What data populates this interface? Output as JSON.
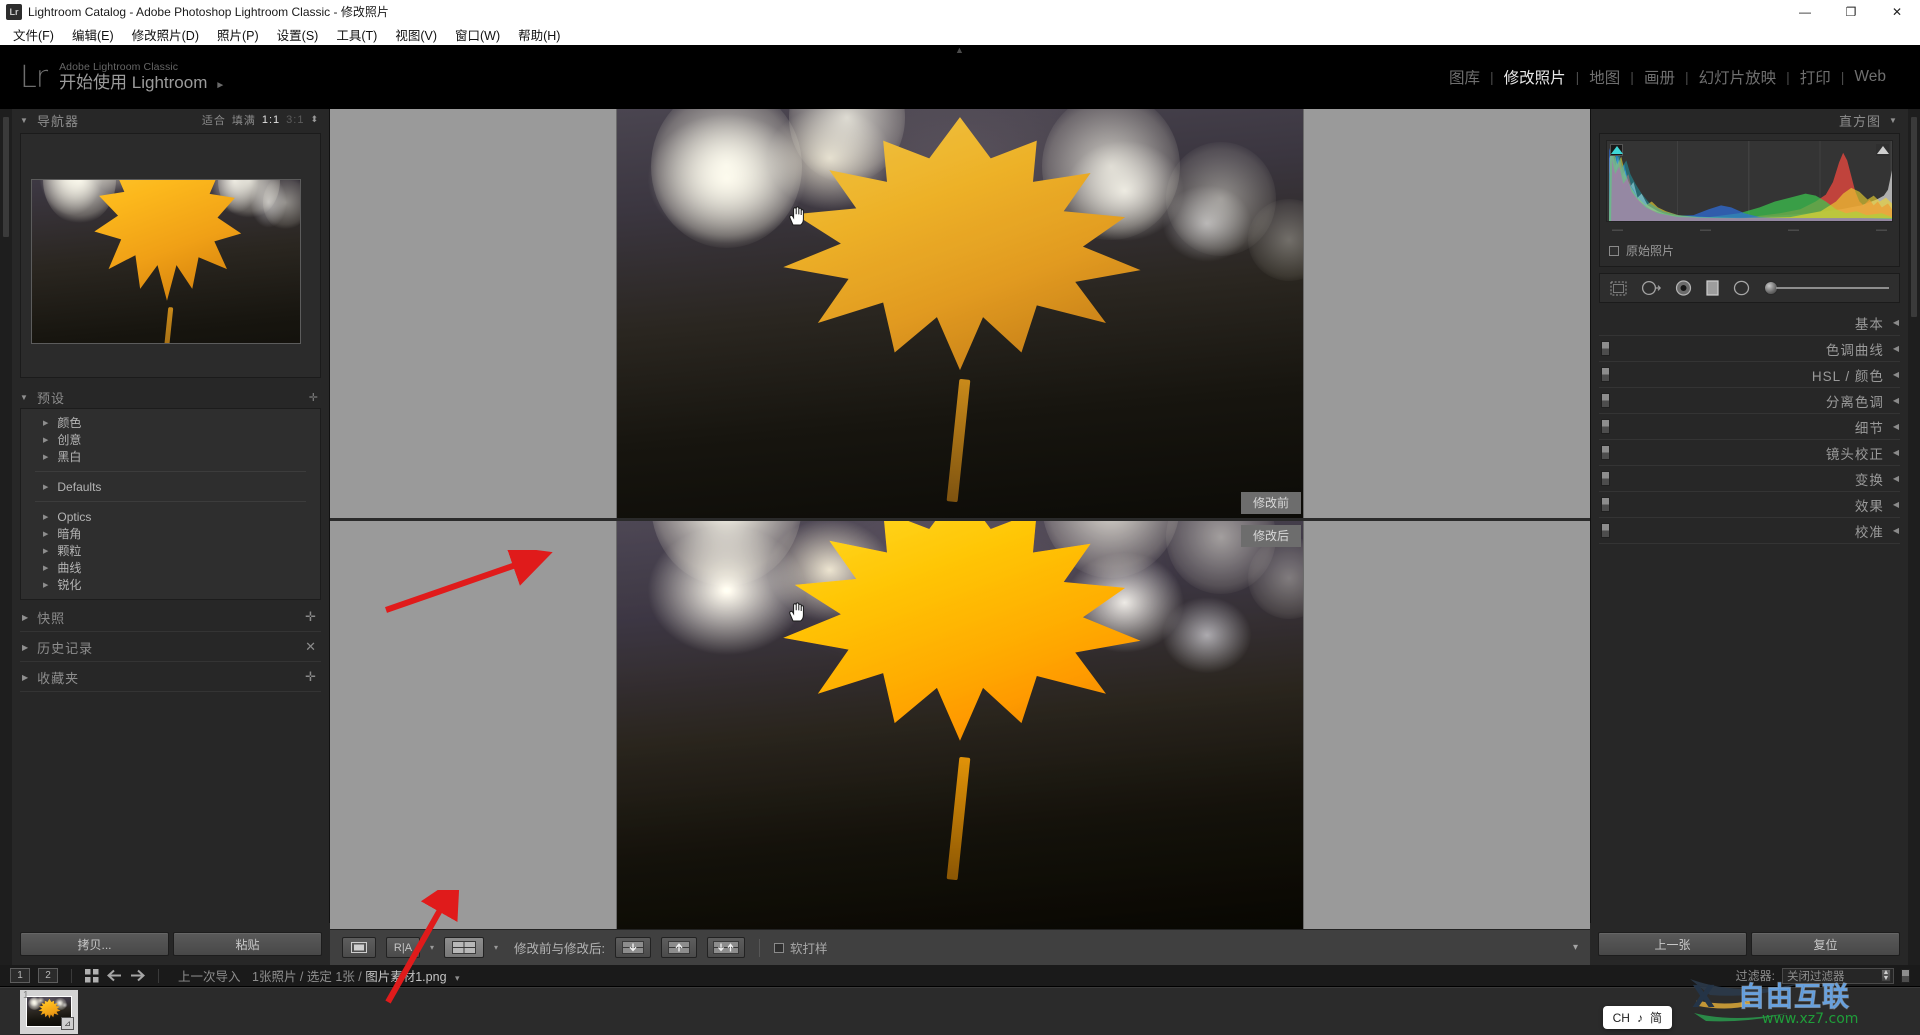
{
  "window": {
    "title": "Lightroom Catalog - Adobe Photoshop Lightroom Classic - 修改照片",
    "logo_text": "Lr",
    "minimize": "—",
    "maximize": "❐",
    "close": "✕"
  },
  "menubar": {
    "items": [
      {
        "label": "文件(F)"
      },
      {
        "label": "编辑(E)"
      },
      {
        "label": "修改照片(D)"
      },
      {
        "label": "照片(P)"
      },
      {
        "label": "设置(S)"
      },
      {
        "label": "工具(T)"
      },
      {
        "label": "视图(V)"
      },
      {
        "label": "窗口(W)"
      },
      {
        "label": "帮助(H)"
      }
    ]
  },
  "identity": {
    "mark": "Lr",
    "subtitle": "Adobe Lightroom Classic",
    "title": "开始使用 Lightroom",
    "arrow": "►"
  },
  "modules": {
    "items": [
      {
        "label": "图库",
        "active": false
      },
      {
        "label": "修改照片",
        "active": true
      },
      {
        "label": "地图",
        "active": false
      },
      {
        "label": "画册",
        "active": false
      },
      {
        "label": "幻灯片放映",
        "active": false
      },
      {
        "label": "打印",
        "active": false
      },
      {
        "label": "Web",
        "active": false
      }
    ],
    "separator": "|"
  },
  "left_panel": {
    "navigator": {
      "title": "导航器",
      "triangle": "▼",
      "zoom_fit": "适合",
      "zoom_fill": "填满",
      "zoom_1to1": "1:1",
      "zoom_3to1": "3:1",
      "spinner": "⬍"
    },
    "presets": {
      "title": "预设",
      "triangle": "▼",
      "add": "✛",
      "groups_top": [
        {
          "label": "颜色"
        },
        {
          "label": "创意"
        },
        {
          "label": "黑白"
        }
      ],
      "groups_mid": [
        {
          "label": "Defaults"
        }
      ],
      "groups_bottom": [
        {
          "label": "Optics"
        },
        {
          "label": "暗角"
        },
        {
          "label": "颗粒"
        },
        {
          "label": "曲线"
        },
        {
          "label": "锐化"
        }
      ],
      "item_triangle": "▶"
    },
    "collapsed": [
      {
        "label": "快照",
        "triangle": "▶",
        "action": "✛"
      },
      {
        "label": "历史记录",
        "triangle": "▶",
        "action": "✕"
      },
      {
        "label": "收藏夹",
        "triangle": "▶",
        "action": "✛"
      }
    ],
    "footer": {
      "copy": "拷贝...",
      "paste": "粘贴"
    }
  },
  "right_panel": {
    "histogram": {
      "title": "直方图",
      "triangle": "▼",
      "ticks": [
        "—",
        "—",
        "—",
        "—"
      ],
      "original_label": "原始照片"
    },
    "tools": [
      {
        "name": "crop-tool",
        "label": "裁剪叠加"
      },
      {
        "name": "spot-removal-tool",
        "label": "污点去除"
      },
      {
        "name": "redeye-tool",
        "label": "红眼校正"
      },
      {
        "name": "graduated-filter-tool",
        "label": "渐变滤镜"
      },
      {
        "name": "radial-filter-tool",
        "label": "径向滤镜"
      },
      {
        "name": "adjustment-brush-tool",
        "label": "调整画笔"
      }
    ],
    "sections": [
      {
        "label": "基本",
        "triangle": "◀",
        "has_switch": false
      },
      {
        "label": "色调曲线",
        "triangle": "◀",
        "has_switch": true
      },
      {
        "label": "HSL / 颜色",
        "triangle": "◀",
        "has_switch": true
      },
      {
        "label": "分离色调",
        "triangle": "◀",
        "has_switch": true
      },
      {
        "label": "细节",
        "triangle": "◀",
        "has_switch": true
      },
      {
        "label": "镜头校正",
        "triangle": "◀",
        "has_switch": true
      },
      {
        "label": "变换",
        "triangle": "◀",
        "has_switch": true
      },
      {
        "label": "效果",
        "triangle": "◀",
        "has_switch": true
      },
      {
        "label": "校准",
        "triangle": "◀",
        "has_switch": true
      }
    ],
    "footer": {
      "previous": "上一张",
      "reset": "复位"
    }
  },
  "stage": {
    "before_label": "修改前",
    "after_label": "修改后"
  },
  "toolbar": {
    "loupe_view": "▭",
    "ra_view": "R|A",
    "before_after_view": "⊻",
    "caret": "▾",
    "before_after_label": "修改前与修改后:",
    "copy_after_to_before": "↓",
    "copy_before_to_after": "↑",
    "swap_before_after": "↓↑",
    "softproof_label": "软打样",
    "collapse_caret": "▾"
  },
  "filmstrip": {
    "screen_1": "1",
    "screen_2": "2",
    "grid_icon": "▦",
    "back_arrow": "◀",
    "forward_arrow": "▶",
    "source": "上一次导入",
    "counts": "1张照片 / 选定 1张 /",
    "filename": "图片素材1.png",
    "path_caret": "▾",
    "filter_label": "过滤器:",
    "filter_value": "关闭过滤器",
    "thumbs": [
      {
        "index": "1",
        "badge": "⊿"
      }
    ]
  },
  "edge_arrows": {
    "top": "▲",
    "bottom": "▼",
    "left": "◀",
    "right": "▶"
  },
  "ime": {
    "lang": "CH",
    "moon": "♪",
    "mode": "简"
  },
  "watermark": {
    "brand": "自由互联",
    "url": "www.xz7.com"
  },
  "colors": {
    "panel_bg": "#272727",
    "stage_bg": "#9a9a9a",
    "accent_text": "#e8e8e8",
    "annotation": "#e01b1b"
  }
}
